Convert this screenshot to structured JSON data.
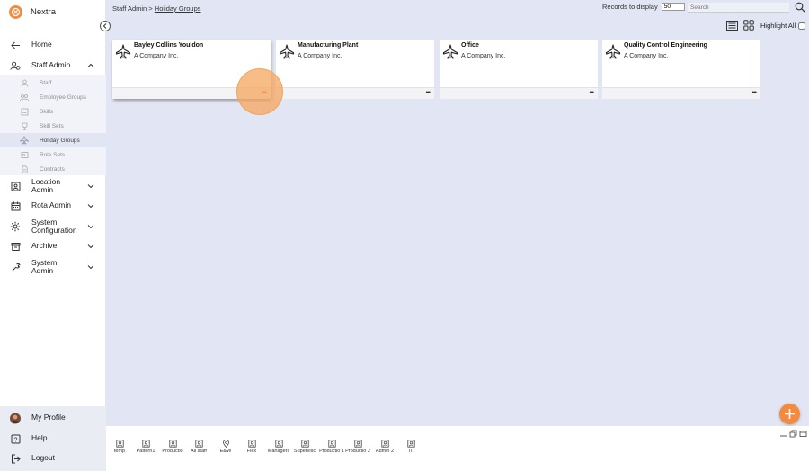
{
  "app": {
    "name": "Nextra"
  },
  "nav": {
    "home": "Home",
    "staff_admin": "Staff Admin",
    "sub_items": [
      "Staff",
      "Employee Groups",
      "Skills",
      "Skill Sets",
      "Holiday Groups",
      "Role Sets",
      "Contracts"
    ],
    "location_admin": "Location Admin",
    "rota_admin": "Rota Admin",
    "system_configuration": "System Configuration",
    "archive": "Archive",
    "system_admin": "System Admin",
    "my_profile": "My Profile",
    "help": "Help",
    "logout": "Logout"
  },
  "breadcrumb": {
    "parent": "Staff Admin",
    "separator": ">",
    "current": "Holiday Groups"
  },
  "toolbar": {
    "records_label": "Records to display",
    "records_value": "50",
    "search_placeholder": "Search",
    "highlight_all": "Highlight All"
  },
  "cards": [
    {
      "title": "Bayley Collins Youldon",
      "subtitle": "A Company Inc.",
      "menu": "•••"
    },
    {
      "title": "Manufacturing Plant",
      "subtitle": "A Company Inc.",
      "menu": "•••"
    },
    {
      "title": "Office",
      "subtitle": "A Company Inc.",
      "menu": "•••"
    },
    {
      "title": "Quality Control Engineering",
      "subtitle": "A Company Inc.",
      "menu": "•••"
    }
  ],
  "patterns": [
    "temp",
    "Pattern1",
    "Productio",
    "All staff",
    "E&W",
    "Flex",
    "Managers",
    "Supervisc",
    "Productio 1",
    "Productio 2",
    "Admin 2",
    "IT"
  ],
  "colors": {
    "accent": "#f28a40",
    "background": "#e2e5f3",
    "danger_dots": "#e35a2c"
  }
}
